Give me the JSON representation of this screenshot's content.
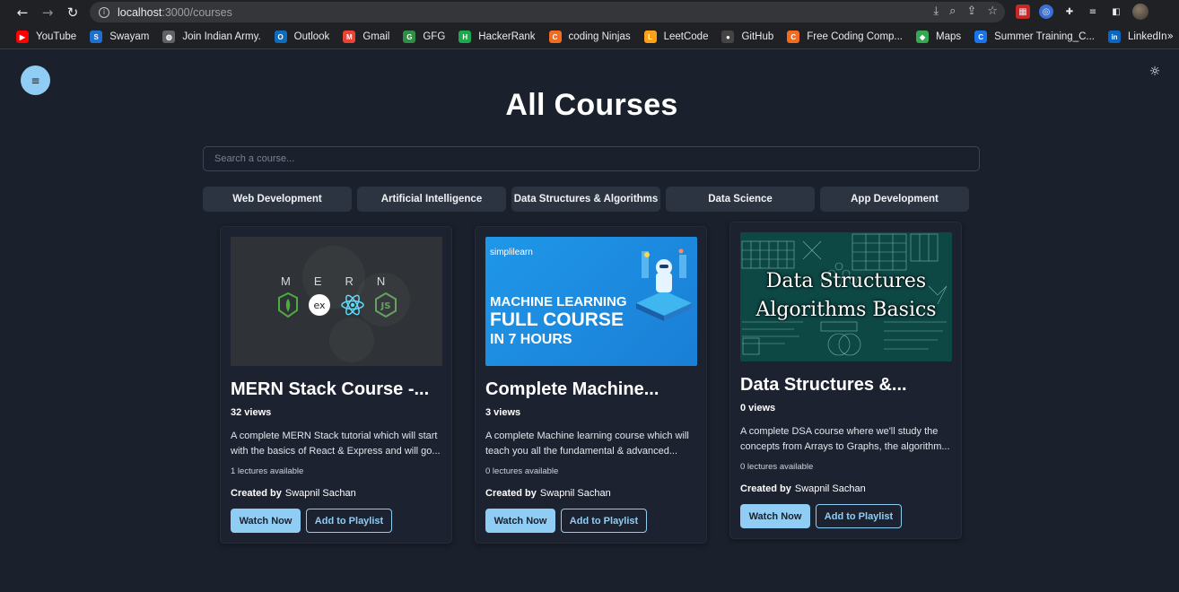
{
  "browser": {
    "url_host": "localhost",
    "url_path": ":3000/courses",
    "bookmarks": [
      {
        "label": "YouTube",
        "icon": "youtube-icon",
        "color": "#ff0000",
        "glyph": "▶"
      },
      {
        "label": "Swayam",
        "icon": "swayam-icon",
        "color": "#1f6fd1",
        "glyph": "S"
      },
      {
        "label": "Join Indian Army.",
        "icon": "globe-icon",
        "color": "#5f6368",
        "glyph": "◍"
      },
      {
        "label": "Outlook",
        "icon": "outlook-icon",
        "color": "#0f6cbd",
        "glyph": "O"
      },
      {
        "label": "Gmail",
        "icon": "gmail-icon",
        "color": "#ea4335",
        "glyph": "M"
      },
      {
        "label": "GFG",
        "icon": "gfg-icon",
        "color": "#2f8d46",
        "glyph": "G"
      },
      {
        "label": "HackerRank",
        "icon": "hackerrank-icon",
        "color": "#1ba94c",
        "glyph": "H"
      },
      {
        "label": "coding Ninjas",
        "icon": "codingninjas-icon",
        "color": "#f26b21",
        "glyph": "C"
      },
      {
        "label": "LeetCode",
        "icon": "leetcode-icon",
        "color": "#ffa116",
        "glyph": "L"
      },
      {
        "label": "GitHub",
        "icon": "github-icon",
        "color": "#444",
        "glyph": "●"
      },
      {
        "label": "Free Coding Comp...",
        "icon": "codingninjas-icon",
        "color": "#f26b21",
        "glyph": "C"
      },
      {
        "label": "Maps",
        "icon": "maps-icon",
        "color": "#34a853",
        "glyph": "◆"
      },
      {
        "label": "Summer Training_C...",
        "icon": "c-icon",
        "color": "#1a73e8",
        "glyph": "C"
      },
      {
        "label": "LinkedIn",
        "icon": "linkedin-icon",
        "color": "#0a66c2",
        "glyph": "in"
      }
    ]
  },
  "page": {
    "title": "All Courses",
    "search_placeholder": "Search a course...",
    "categories": [
      "Web Development",
      "Artificial Intelligence",
      "Data Structures & Algorithms",
      "Data Science",
      "App Development"
    ],
    "created_by_label": "Created by",
    "watch_label": "Watch Now",
    "playlist_label": "Add to Playlist"
  },
  "courses": [
    {
      "title": "MERN Stack Course -...",
      "views": "32 views",
      "description": "A complete MERN Stack tutorial which will start with the basics of React & Express and will go...",
      "lectures": "1 lectures available",
      "creator": "Swapnil Sachan",
      "thumb_letters": [
        "M",
        "E",
        "R",
        "N"
      ]
    },
    {
      "title": "Complete Machine...",
      "views": "3 views",
      "description": "A complete Machine learning course which will teach you all the fundamental & advanced...",
      "lectures": "0 lectures available",
      "creator": "Swapnil Sachan",
      "thumb_brand": "simplilearn",
      "thumb_lines": [
        "MACHINE LEARNING",
        "FULL COURSE",
        "IN 7 HOURS"
      ]
    },
    {
      "title": "Data Structures &...",
      "views": "0 views",
      "description": "A complete DSA course where we'll study the concepts from Arrays to Graphs, the algorithm...",
      "lectures": "0 lectures available",
      "creator": "Swapnil Sachan",
      "thumb_lines": [
        "Data Structures",
        "Algorithms Basics"
      ]
    }
  ],
  "colors": {
    "background": "#1a202c",
    "accent": "#90cdf4",
    "category_bg": "#2d3441"
  }
}
